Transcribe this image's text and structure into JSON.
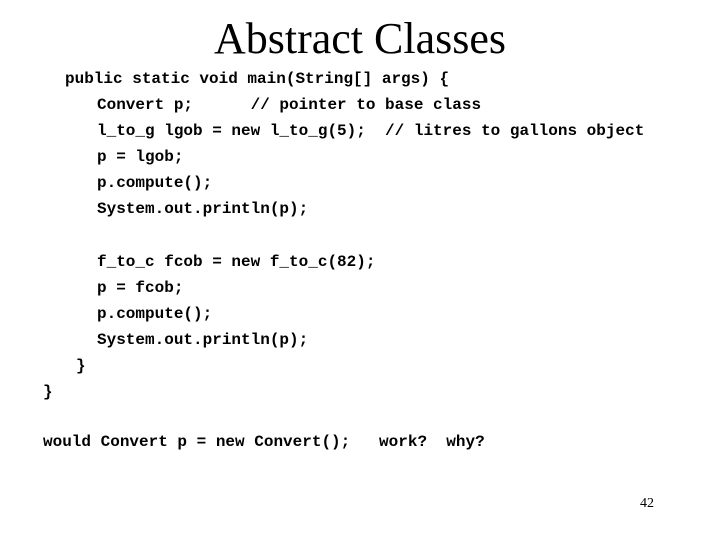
{
  "slide": {
    "title": "Abstract Classes",
    "page_number": "42"
  },
  "code": {
    "lines": [
      "public static void main(String[] args) {",
      "Convert p;      // pointer to base class",
      "l_to_g lgob = new l_to_g(5);  // litres to gallons object",
      "p = lgob;",
      "p.compute();",
      "System.out.println(p);",
      "f_to_c fcob = new f_to_c(82);",
      "p = fcob;",
      "p.compute();",
      "System.out.println(p);",
      "}",
      "}"
    ]
  },
  "question": {
    "text": "would Convert p = new Convert();   work?  why?"
  }
}
